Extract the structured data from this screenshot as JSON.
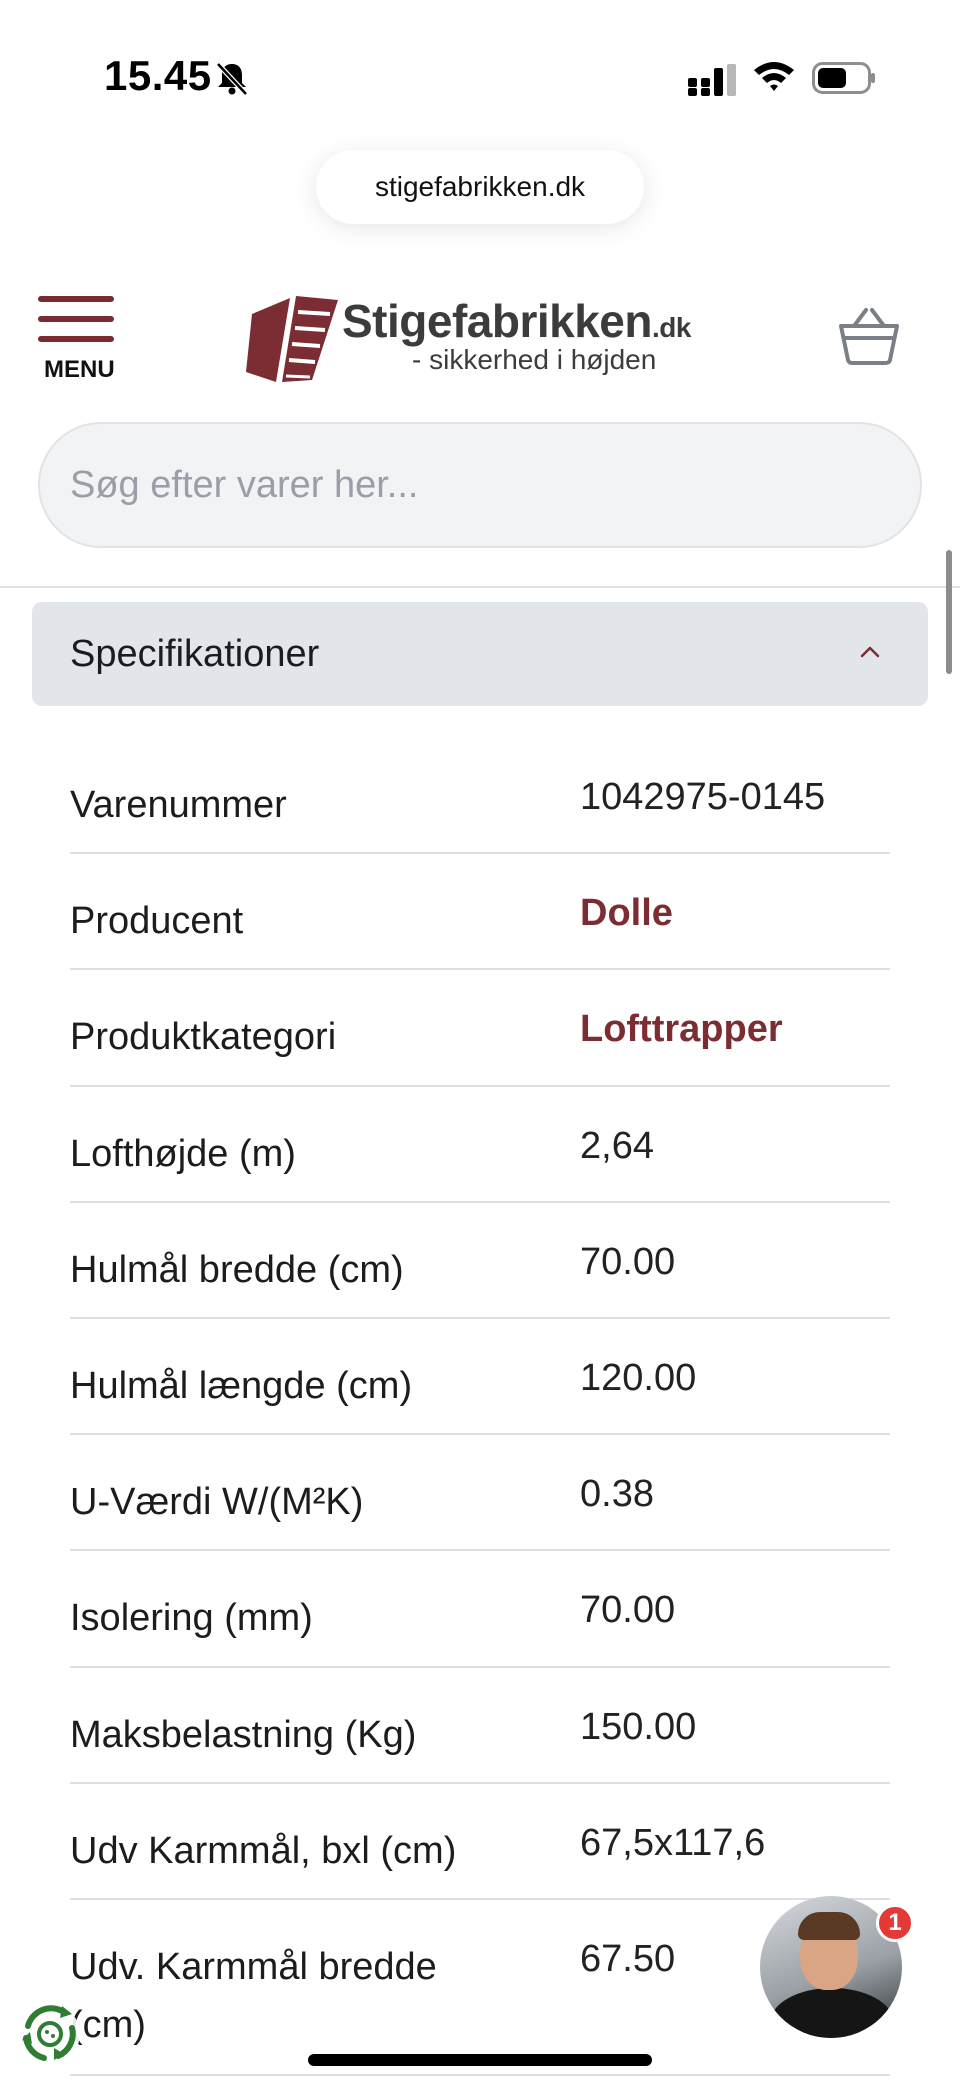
{
  "status_bar": {
    "time": "15.45",
    "icons": [
      "bell-slash-icon",
      "cellular-signal-icon",
      "wifi-icon",
      "battery-icon"
    ]
  },
  "browser": {
    "url": "stigefabrikken.dk"
  },
  "header": {
    "menu_label": "MENU",
    "logo_name": "Stigefabrikken",
    "logo_tld": ".dk",
    "logo_tagline": "- sikkerhed i højden",
    "cart_icon": "basket-icon"
  },
  "search": {
    "placeholder": "Søg efter varer her..."
  },
  "specifications": {
    "title": "Specifikationer",
    "expanded": true,
    "rows": [
      {
        "label": "Varenummer",
        "value": "1042975-0145",
        "link": false
      },
      {
        "label": "Producent",
        "value": "Dolle",
        "link": true
      },
      {
        "label": "Produktkategori",
        "value": "Lofttrapper",
        "link": true
      },
      {
        "label": "Lofthøjde (m)",
        "value": "2,64",
        "link": false
      },
      {
        "label": "Hulmål bredde (cm)",
        "value": "70.00",
        "link": false
      },
      {
        "label": "Hulmål længde (cm)",
        "value": "120.00",
        "link": false
      },
      {
        "label": "U-Værdi W/(M²K)",
        "value": "0.38",
        "link": false
      },
      {
        "label": "Isolering (mm)",
        "value": "70.00",
        "link": false
      },
      {
        "label": "Maksbelastning (Kg)",
        "value": "150.00",
        "link": false
      },
      {
        "label": "Udv Karmmål, bxl (cm)",
        "value": "67,5x117,6",
        "link": false
      },
      {
        "label": "Udv. Karmmål bredde (cm)",
        "value": "67.50",
        "link": false
      }
    ]
  },
  "chat_widget": {
    "badge_count": "1"
  },
  "colors": {
    "brand": "#7b2d33",
    "accordion_bg": "#e2e5ea",
    "search_bg": "#f1f3f5",
    "badge": "#e53935"
  }
}
